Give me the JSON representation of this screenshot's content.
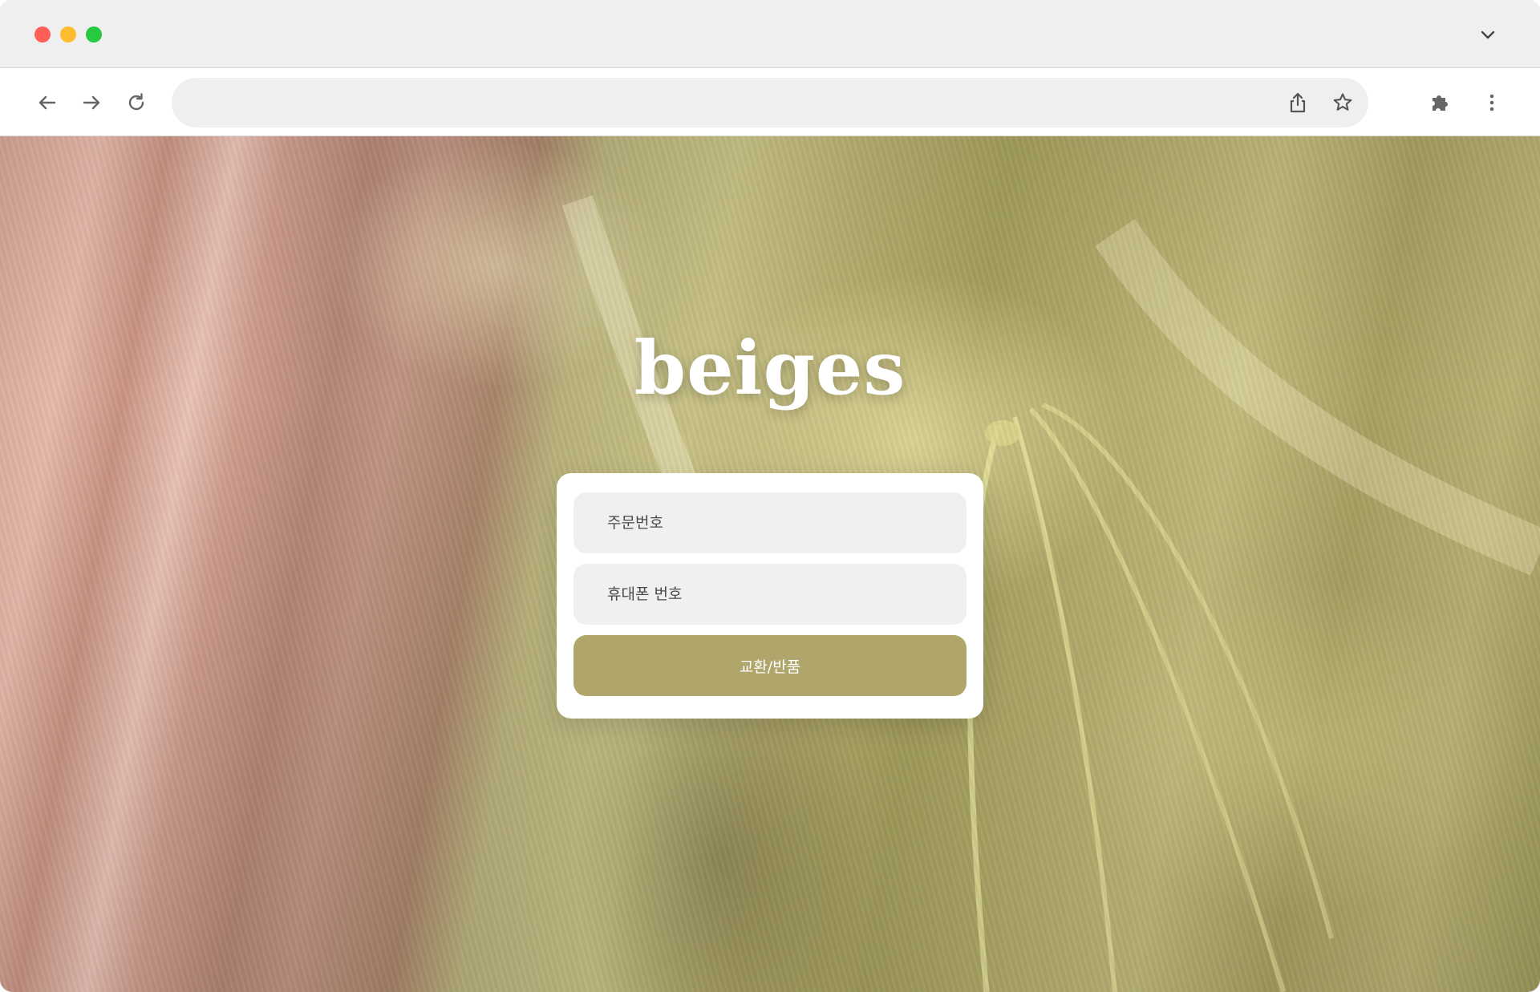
{
  "browser": {
    "address_bar_value": "",
    "icons": [
      "back-arrow-icon",
      "forward-arrow-icon",
      "reload-icon",
      "share-icon",
      "star-icon",
      "puzzle-extension-icon",
      "kebab-menu-icon",
      "chevron-down-icon"
    ]
  },
  "page": {
    "brand": "beiges",
    "form": {
      "order_number_placeholder": "주문번호",
      "phone_placeholder": "휴대폰 번호",
      "submit_label": "교환/반품"
    }
  },
  "colors": {
    "accent": "#b0a56a",
    "field_bg": "#f0f0f0",
    "card_bg": "#ffffff"
  }
}
